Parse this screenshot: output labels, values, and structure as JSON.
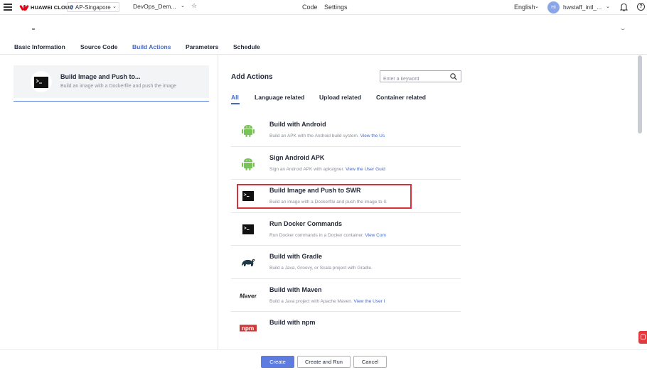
{
  "topbar": {
    "brand": "HUAWEI CLOUD",
    "region": "AP-Singapore",
    "project": "DevOps_Dem...",
    "nav": [
      "Code",
      "Settings"
    ],
    "language": "English",
    "avatar_initials": "HI",
    "username": "hwstaff_intl_..."
  },
  "tabs": [
    {
      "label": "Basic Information",
      "active": false
    },
    {
      "label": "Source Code",
      "active": false
    },
    {
      "label": "Build Actions",
      "active": true
    },
    {
      "label": "Parameters",
      "active": false
    },
    {
      "label": "Schedule",
      "active": false
    }
  ],
  "selected_step": {
    "title": "Build Image and Push to...",
    "description": "Build an image with a Dockerfile and push the image"
  },
  "add_actions": {
    "heading": "Add Actions",
    "search_placeholder": "Enter a keyword",
    "filters": [
      "All",
      "Language related",
      "Upload related",
      "Container related"
    ],
    "active_filter": "All",
    "items": [
      {
        "icon": "android-icon",
        "title": "Build with Android",
        "desc": "Build an APK with the Android build system.",
        "link": "View the Us"
      },
      {
        "icon": "android-icon",
        "title": "Sign Android APK",
        "desc": "Sign an Android APK with apksigner.",
        "link": "View the User Guid"
      },
      {
        "icon": "terminal-icon",
        "title": "Build Image and Push to SWR",
        "desc": "Build an image with a Dockerfile and push the image to S",
        "link": ""
      },
      {
        "icon": "terminal-icon",
        "title": "Run Docker Commands",
        "desc": "Run Docker commands in a Docker container.",
        "link": "View Com"
      },
      {
        "icon": "gradle-icon",
        "title": "Build with Gradle",
        "desc": "Build a Java, Groovy, or Scala project with Gradle.",
        "link": ""
      },
      {
        "icon": "maven-icon",
        "title": "Build with Maven",
        "desc": "Build a Java project with Apache Maven.",
        "link": "View the User I"
      },
      {
        "icon": "npm-icon",
        "title": "Build with npm",
        "desc": "",
        "link": ""
      }
    ]
  },
  "footer": {
    "create": "Create",
    "create_and_run": "Create and Run",
    "cancel": "Cancel"
  },
  "colors": {
    "accent": "#5e7ce0",
    "active_tab": "#4669c9",
    "highlight": "#d9303c",
    "android": "#78c257"
  }
}
